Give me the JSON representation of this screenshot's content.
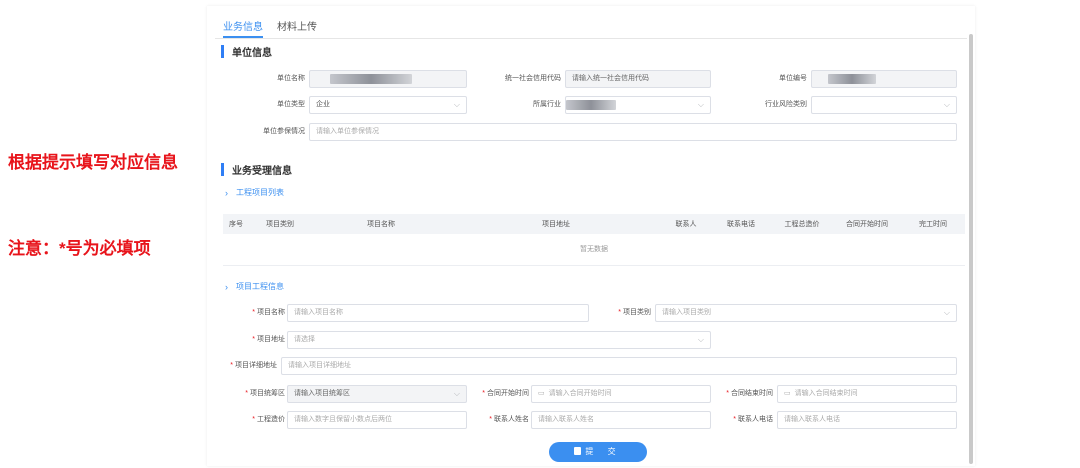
{
  "notes": {
    "instruction": "根据提示填写对应信息",
    "attention": "注意：*号为必填项"
  },
  "tabs": [
    {
      "label": "业务信息",
      "active": true
    },
    {
      "label": "材料上传",
      "active": false
    }
  ],
  "unit_section": {
    "title": "单位信息",
    "fields": {
      "unit_name": {
        "label": "单位名称",
        "value": ""
      },
      "credit_code": {
        "label": "统一社会信用代码",
        "placeholder": "请输入统一社会信用代码"
      },
      "unit_number": {
        "label": "单位编号",
        "value": ""
      },
      "unit_type": {
        "label": "单位类型",
        "value": "企业"
      },
      "industry": {
        "label": "所属行业",
        "value": ""
      },
      "risk_category": {
        "label": "行业风险类别",
        "value": ""
      },
      "insurance_status": {
        "label": "单位参保情况",
        "placeholder": "请输入单位参保情况"
      }
    }
  },
  "business_section": {
    "title": "业务受理信息",
    "project_list": {
      "title": "工程项目列表",
      "columns": [
        "序号",
        "项目类别",
        "项目名称",
        "项目地址",
        "联系人",
        "联系电话",
        "工程总造价",
        "合同开始时间",
        "完工时间"
      ],
      "empty_text": "暂无数据"
    },
    "project_info": {
      "title": "项目工程信息",
      "fields": {
        "project_name": {
          "label": "项目名称",
          "placeholder": "请输入项目名称"
        },
        "project_category": {
          "label": "项目类别",
          "placeholder": "请输入项目类别"
        },
        "project_address": {
          "label": "项目地址",
          "placeholder": "请选择"
        },
        "project_detail_address": {
          "label": "项目详细地址",
          "placeholder": "请输入项目详细地址"
        },
        "project_district": {
          "label": "项目统筹区",
          "placeholder": "请输入项目统筹区"
        },
        "contract_start": {
          "label": "合同开始时间",
          "placeholder": "请输入合同开始时间"
        },
        "contract_end": {
          "label": "合同结束时间",
          "placeholder": "请输入合同结束时间"
        },
        "cost": {
          "label": "工程造价",
          "placeholder": "请输入数字且保留小数点后两位"
        },
        "contact_name": {
          "label": "联系人姓名",
          "placeholder": "请输入联系人姓名"
        },
        "contact_phone": {
          "label": "联系人电话",
          "placeholder": "请输入联系人电话"
        }
      }
    }
  },
  "submit_label": "提 交",
  "colors": {
    "accent": "#3b8ff0",
    "required": "#e8141b",
    "note": "#e8141b"
  }
}
